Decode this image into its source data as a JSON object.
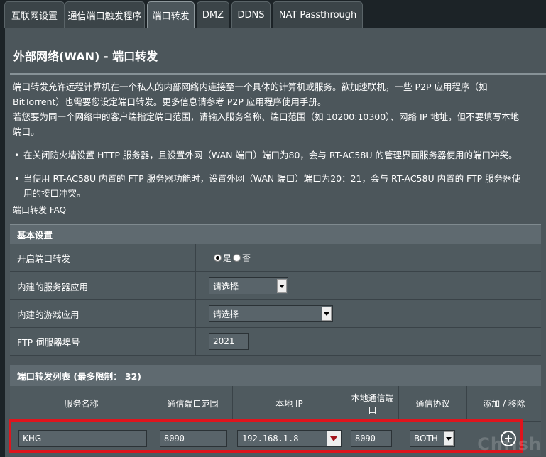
{
  "tabs": [
    {
      "label": "互联网设置",
      "active": false
    },
    {
      "label": "通信端口触发程序",
      "active": false
    },
    {
      "label": "端口转发",
      "active": true
    },
    {
      "label": "DMZ",
      "active": false
    },
    {
      "label": "DDNS",
      "active": false
    },
    {
      "label": "NAT Passthrough",
      "active": false
    }
  ],
  "page": {
    "title": "外部网络(WAN) - 端口转发",
    "desc_lines": [
      "端口转发允许远程计算机在一个私人的内部网络内连接至一个具体的计算机或服务。欲加速联机，一些 P2P 应用程序（如",
      "BitTorrent）也需要您设定端口转发。更多信息请参考 P2P 应用程序使用手册。",
      "若您要为同一个网络中的客户端指定端口范围，请输入服务名称、端口范围（如 10200:10300）、网络 IP 地址，但不要填写本地",
      "端口。"
    ],
    "bullets": [
      {
        "line1": "在关闭防火墙设置 HTTP 服务器，且设置外网（WAN 端口）端口为80，会与 RT-AC58U 的管理界面服务器使用的端口冲突。",
        "line2": ""
      },
      {
        "line1": "当使用 RT-AC58U 内置的 FTP 服务器功能时，设置外网（WAN 端口）端口为20：21，会与 RT-AC58U 内置的 FTP 服务器使",
        "line2": "用的接口冲突。"
      }
    ],
    "faq_link": "端口转发  FAQ"
  },
  "basic": {
    "header": "基本设置",
    "enable_label": "开启端口转发",
    "radio_yes": "是",
    "radio_no": "否",
    "radio_selected": "yes",
    "server_app_label": "内建的服务器应用",
    "server_app_value": "请选择",
    "game_app_label": "内建的游戏应用",
    "game_app_value": "请选择",
    "ftp_port_label": "FTP 伺服器埠号",
    "ftp_port_value": "2021"
  },
  "list": {
    "header": "端口转发列表 (最多限制： 32)",
    "columns": [
      "服务名称",
      "通信端口范围",
      "本地 IP",
      "本地通信端口",
      "通信协议",
      "添加 / 移除"
    ],
    "row": {
      "service": "KHG",
      "port_range": "8090",
      "local_ip": "192.168.1.8",
      "local_port": "8090",
      "protocol": "BOTH"
    }
  },
  "watermark": "Chfish",
  "colors": {
    "highlight_box": "#e0141c",
    "panel": "#4c565b",
    "background": "#1c2327"
  },
  "icons": [
    "dropdown-arrow-icon",
    "add-circle-icon",
    "radio-icon"
  ]
}
